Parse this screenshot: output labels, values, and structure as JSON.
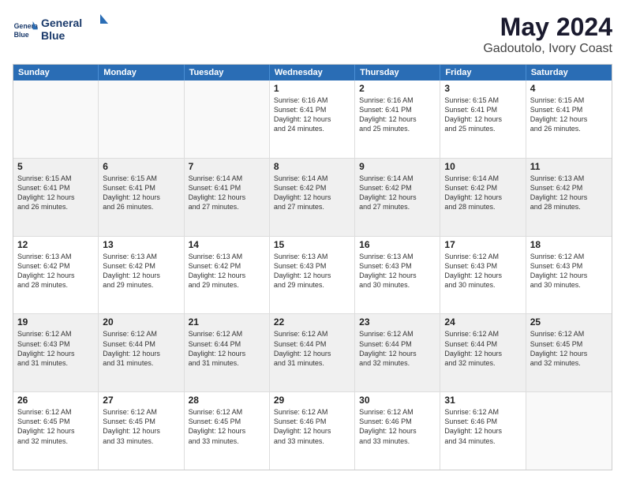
{
  "logo": {
    "line1": "General",
    "line2": "Blue"
  },
  "title": "May 2024",
  "subtitle": "Gadoutolo, Ivory Coast",
  "days": [
    "Sunday",
    "Monday",
    "Tuesday",
    "Wednesday",
    "Thursday",
    "Friday",
    "Saturday"
  ],
  "weeks": [
    [
      {
        "day": "",
        "text": ""
      },
      {
        "day": "",
        "text": ""
      },
      {
        "day": "",
        "text": ""
      },
      {
        "day": "1",
        "text": "Sunrise: 6:16 AM\nSunset: 6:41 PM\nDaylight: 12 hours\nand 24 minutes."
      },
      {
        "day": "2",
        "text": "Sunrise: 6:16 AM\nSunset: 6:41 PM\nDaylight: 12 hours\nand 25 minutes."
      },
      {
        "day": "3",
        "text": "Sunrise: 6:15 AM\nSunset: 6:41 PM\nDaylight: 12 hours\nand 25 minutes."
      },
      {
        "day": "4",
        "text": "Sunrise: 6:15 AM\nSunset: 6:41 PM\nDaylight: 12 hours\nand 26 minutes."
      }
    ],
    [
      {
        "day": "5",
        "text": "Sunrise: 6:15 AM\nSunset: 6:41 PM\nDaylight: 12 hours\nand 26 minutes."
      },
      {
        "day": "6",
        "text": "Sunrise: 6:15 AM\nSunset: 6:41 PM\nDaylight: 12 hours\nand 26 minutes."
      },
      {
        "day": "7",
        "text": "Sunrise: 6:14 AM\nSunset: 6:41 PM\nDaylight: 12 hours\nand 27 minutes."
      },
      {
        "day": "8",
        "text": "Sunrise: 6:14 AM\nSunset: 6:42 PM\nDaylight: 12 hours\nand 27 minutes."
      },
      {
        "day": "9",
        "text": "Sunrise: 6:14 AM\nSunset: 6:42 PM\nDaylight: 12 hours\nand 27 minutes."
      },
      {
        "day": "10",
        "text": "Sunrise: 6:14 AM\nSunset: 6:42 PM\nDaylight: 12 hours\nand 28 minutes."
      },
      {
        "day": "11",
        "text": "Sunrise: 6:13 AM\nSunset: 6:42 PM\nDaylight: 12 hours\nand 28 minutes."
      }
    ],
    [
      {
        "day": "12",
        "text": "Sunrise: 6:13 AM\nSunset: 6:42 PM\nDaylight: 12 hours\nand 28 minutes."
      },
      {
        "day": "13",
        "text": "Sunrise: 6:13 AM\nSunset: 6:42 PM\nDaylight: 12 hours\nand 29 minutes."
      },
      {
        "day": "14",
        "text": "Sunrise: 6:13 AM\nSunset: 6:42 PM\nDaylight: 12 hours\nand 29 minutes."
      },
      {
        "day": "15",
        "text": "Sunrise: 6:13 AM\nSunset: 6:43 PM\nDaylight: 12 hours\nand 29 minutes."
      },
      {
        "day": "16",
        "text": "Sunrise: 6:13 AM\nSunset: 6:43 PM\nDaylight: 12 hours\nand 30 minutes."
      },
      {
        "day": "17",
        "text": "Sunrise: 6:12 AM\nSunset: 6:43 PM\nDaylight: 12 hours\nand 30 minutes."
      },
      {
        "day": "18",
        "text": "Sunrise: 6:12 AM\nSunset: 6:43 PM\nDaylight: 12 hours\nand 30 minutes."
      }
    ],
    [
      {
        "day": "19",
        "text": "Sunrise: 6:12 AM\nSunset: 6:43 PM\nDaylight: 12 hours\nand 31 minutes."
      },
      {
        "day": "20",
        "text": "Sunrise: 6:12 AM\nSunset: 6:44 PM\nDaylight: 12 hours\nand 31 minutes."
      },
      {
        "day": "21",
        "text": "Sunrise: 6:12 AM\nSunset: 6:44 PM\nDaylight: 12 hours\nand 31 minutes."
      },
      {
        "day": "22",
        "text": "Sunrise: 6:12 AM\nSunset: 6:44 PM\nDaylight: 12 hours\nand 31 minutes."
      },
      {
        "day": "23",
        "text": "Sunrise: 6:12 AM\nSunset: 6:44 PM\nDaylight: 12 hours\nand 32 minutes."
      },
      {
        "day": "24",
        "text": "Sunrise: 6:12 AM\nSunset: 6:44 PM\nDaylight: 12 hours\nand 32 minutes."
      },
      {
        "day": "25",
        "text": "Sunrise: 6:12 AM\nSunset: 6:45 PM\nDaylight: 12 hours\nand 32 minutes."
      }
    ],
    [
      {
        "day": "26",
        "text": "Sunrise: 6:12 AM\nSunset: 6:45 PM\nDaylight: 12 hours\nand 32 minutes."
      },
      {
        "day": "27",
        "text": "Sunrise: 6:12 AM\nSunset: 6:45 PM\nDaylight: 12 hours\nand 33 minutes."
      },
      {
        "day": "28",
        "text": "Sunrise: 6:12 AM\nSunset: 6:45 PM\nDaylight: 12 hours\nand 33 minutes."
      },
      {
        "day": "29",
        "text": "Sunrise: 6:12 AM\nSunset: 6:46 PM\nDaylight: 12 hours\nand 33 minutes."
      },
      {
        "day": "30",
        "text": "Sunrise: 6:12 AM\nSunset: 6:46 PM\nDaylight: 12 hours\nand 33 minutes."
      },
      {
        "day": "31",
        "text": "Sunrise: 6:12 AM\nSunset: 6:46 PM\nDaylight: 12 hours\nand 34 minutes."
      },
      {
        "day": "",
        "text": ""
      }
    ]
  ]
}
